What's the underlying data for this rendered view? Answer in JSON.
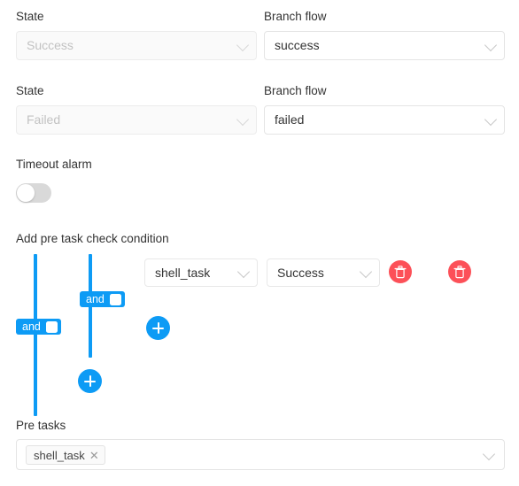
{
  "rows": [
    {
      "state": {
        "label": "State",
        "value": "Success",
        "disabled": true,
        "icon": "chevron-down-icon"
      },
      "branch": {
        "label": "Branch flow",
        "value": "success",
        "disabled": false,
        "icon": "chevron-down-icon"
      }
    },
    {
      "state": {
        "label": "State",
        "value": "Failed",
        "disabled": true,
        "icon": "chevron-down-icon"
      },
      "branch": {
        "label": "Branch flow",
        "value": "failed",
        "disabled": false,
        "icon": "chevron-down-icon"
      }
    }
  ],
  "timeout_alarm": {
    "label": "Timeout alarm",
    "enabled": false,
    "icon": "toggle-switch-off-icon"
  },
  "condition_builder": {
    "title": "Add pre task check condition",
    "groups": [
      {
        "operator": "and",
        "checkbox_checked": false
      },
      {
        "operator": "and",
        "checkbox_checked": false
      }
    ],
    "condition_row": {
      "task": {
        "value": "shell_task",
        "icon": "chevron-down-icon"
      },
      "state": {
        "value": "Success",
        "icon": "chevron-down-icon"
      },
      "delete_icons": [
        "trash-icon",
        "trash-icon"
      ]
    },
    "add_buttons": [
      "plus-icon",
      "plus-icon"
    ],
    "colors": {
      "accent": "#0d9bf5",
      "danger": "#fc5058"
    }
  },
  "pre_tasks": {
    "label": "Pre tasks",
    "tags": [
      {
        "text": "shell_task",
        "close_icon": "close-icon"
      }
    ],
    "icon": "chevron-down-icon"
  }
}
